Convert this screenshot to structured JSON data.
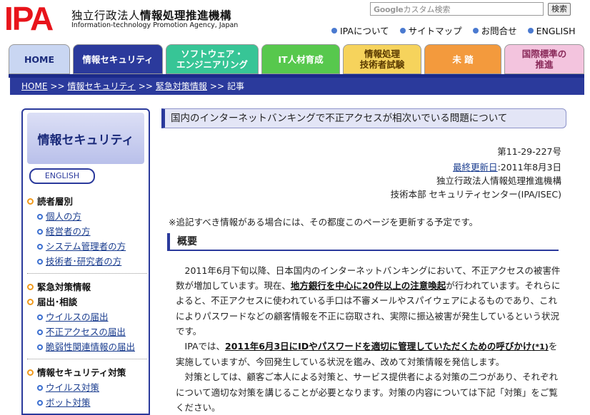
{
  "header": {
    "logo_text": "IPA",
    "org_prefix": "独立行政法人",
    "org_name": "情報処理推進機構",
    "org_english": "Information-technology Promotion Agency, Japan",
    "search_brand": "Google",
    "search_placeholder": "カスタム検索",
    "search_button": "検索",
    "util_links": [
      "IPAについて",
      "サイトマップ",
      "お問合せ",
      "ENGLISH"
    ]
  },
  "tabs": [
    {
      "label": "HOME",
      "color": "#c9d6f2",
      "text": "#1a2a7a"
    },
    {
      "label": "情報セキュリティ",
      "color": "#2b3a9c",
      "text": "#ffffff"
    },
    {
      "label": "ソフトウェア・\nエンジニアリング",
      "color": "#37c596",
      "text": "#ffffff"
    },
    {
      "label": "IT人材育成",
      "color": "#57c84d",
      "text": "#ffffff"
    },
    {
      "label": "情報処理\n技術者試験",
      "color": "#f6d35c",
      "text": "#5a3a00"
    },
    {
      "label": "未 踏",
      "color": "#f39a3d",
      "text": "#ffffff"
    },
    {
      "label": "国際標準の\n推進",
      "color": "#f3c4de",
      "text": "#8a2a5a"
    }
  ],
  "breadcrumb": [
    "HOME",
    "情報セキュリティ",
    "緊急対策情報",
    "記事"
  ],
  "breadcrumb_sep": ">>",
  "sidebar": {
    "title": "情報セキュリティ",
    "english": "ENGLISH",
    "sections": [
      {
        "label": "読者層別",
        "items": [
          "個人の方",
          "経営者の方",
          "システム管理者の方",
          "技術者･研究者の方"
        ]
      },
      {
        "label": "緊急対策情報",
        "items": []
      },
      {
        "label": "届出･相談",
        "items": [
          "ウイルスの届出",
          "不正アクセスの届出",
          "脆弱性関連情報の届出"
        ]
      },
      {
        "label": "情報セキュリティ対策",
        "items": [
          "ウイルス対策",
          "ボット対策"
        ]
      }
    ]
  },
  "main": {
    "title": "国内のインターネットバンキングで不正アクセスが相次いでいる問題について",
    "doc_number": "第11-29-227号",
    "last_updated_label": "最終更新日",
    "last_updated_value": ":2011年8月3日",
    "org": "独立行政法人情報処理推進機構",
    "dept": "技術本部 セキュリティセンター(IPA/ISEC)",
    "notice": "※追記すべき情報がある場合には、その都度このページを更新する予定です。",
    "section_heading": "概要",
    "p1_a": "2011年6月下旬以降、日本国内のインターネットバンキングにおいて、不正アクセスの被害件数が増加しています。現在、",
    "p1_bold": "地方銀行を中心に20件以上の注意喚起",
    "p1_b": "が行われています。それらによると、不正アクセスに使われている手口は不審メールやスパイウェアによるものであり、これによりパスワードなどの顧客情報を不正に窃取され、実際に振込被害が発生しているという状況です。",
    "p2_a": "IPAでは、",
    "p2_link": "2011年6月3日にIDやパスワードを適切に管理していただくための呼びかけ",
    "p2_note": "(*1)",
    "p2_b": "を実施していますが、今回発生している状況を鑑み、改めて対策情報を発信します。",
    "p3": "対策としては、顧客ご本人による対策と、サービス提供者による対策の二つがあり、それぞれについて適切な対策を講じることが必要となります。対策の内容については下記「対策」をご覧ください。"
  }
}
